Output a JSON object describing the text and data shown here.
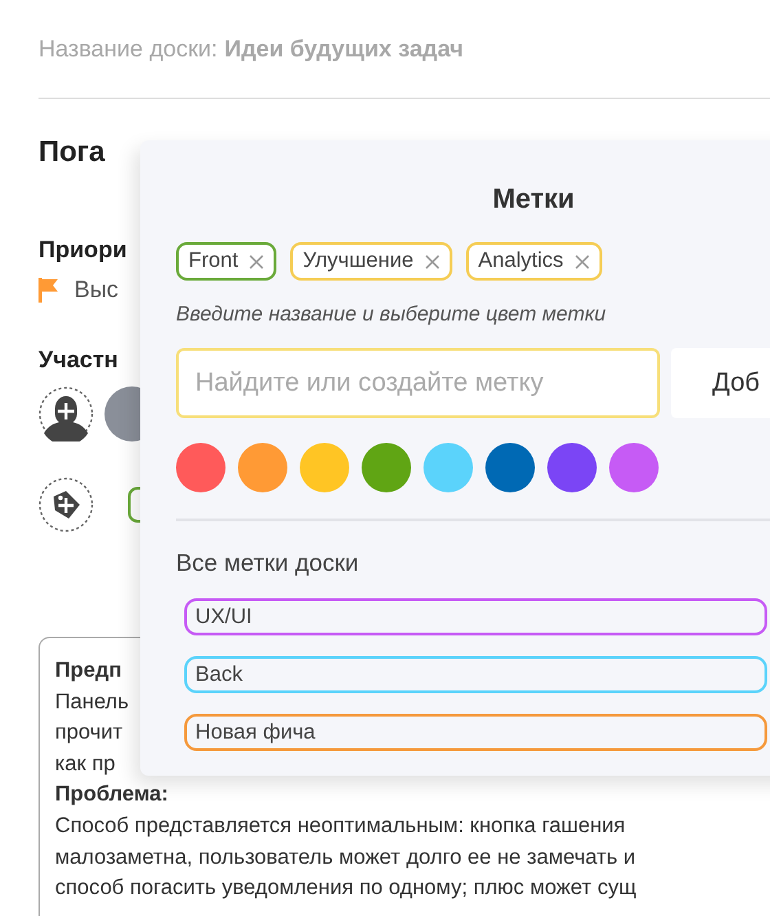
{
  "board": {
    "label": "Название доски:",
    "name": "Идеи будущих задач"
  },
  "task": {
    "title": "Пога",
    "priority_label": "Приори",
    "priority_value": "Выс",
    "members_label": "Участн",
    "tags": [
      {
        "color": "#6aaa3a"
      }
    ],
    "description": [
      {
        "kind": "heading",
        "text": "Предп"
      },
      {
        "kind": "text",
        "text": "Панель"
      },
      {
        "kind": "text",
        "text": "прочит"
      },
      {
        "kind": "text",
        "text": "как пр"
      },
      {
        "kind": "heading",
        "text": "Проблема:"
      },
      {
        "kind": "text",
        "text": "Способ представляется неоптимальным: кнопка гашения"
      },
      {
        "kind": "text",
        "text": "малозаметна, пользователь может долго ее не замечать и"
      },
      {
        "kind": "text",
        "text": "способ погасить уведомления по одному; плюс может сущ"
      }
    ]
  },
  "labels_popup": {
    "title": "Метки",
    "selected_tags": [
      {
        "label": "Front",
        "color": "#6aaa3a"
      },
      {
        "label": "Улучшение",
        "color": "#f5cd55"
      },
      {
        "label": "Analytics",
        "color": "#f5cd55"
      }
    ],
    "hint": "Введите название и выберите цвет метки",
    "search": {
      "placeholder": "Найдите или создайте метку"
    },
    "add_button": "Доб",
    "colors": [
      {
        "color": "#ff5a5a"
      },
      {
        "color": "#ff9a35"
      },
      {
        "color": "#ffc524"
      },
      {
        "color": "#60a514"
      },
      {
        "color": "#5bd3fb"
      },
      {
        "color": "#0069b4"
      },
      {
        "color": "#7b45f5"
      },
      {
        "color": "#c65bf5"
      }
    ],
    "all_label": "Все метки доски",
    "board_tags": [
      {
        "label": "UX/UI",
        "color": "#c65bf5"
      },
      {
        "label": "Back",
        "color": "#5bd3fb"
      },
      {
        "label": "Новая фича",
        "color": "#f5993c"
      }
    ]
  }
}
